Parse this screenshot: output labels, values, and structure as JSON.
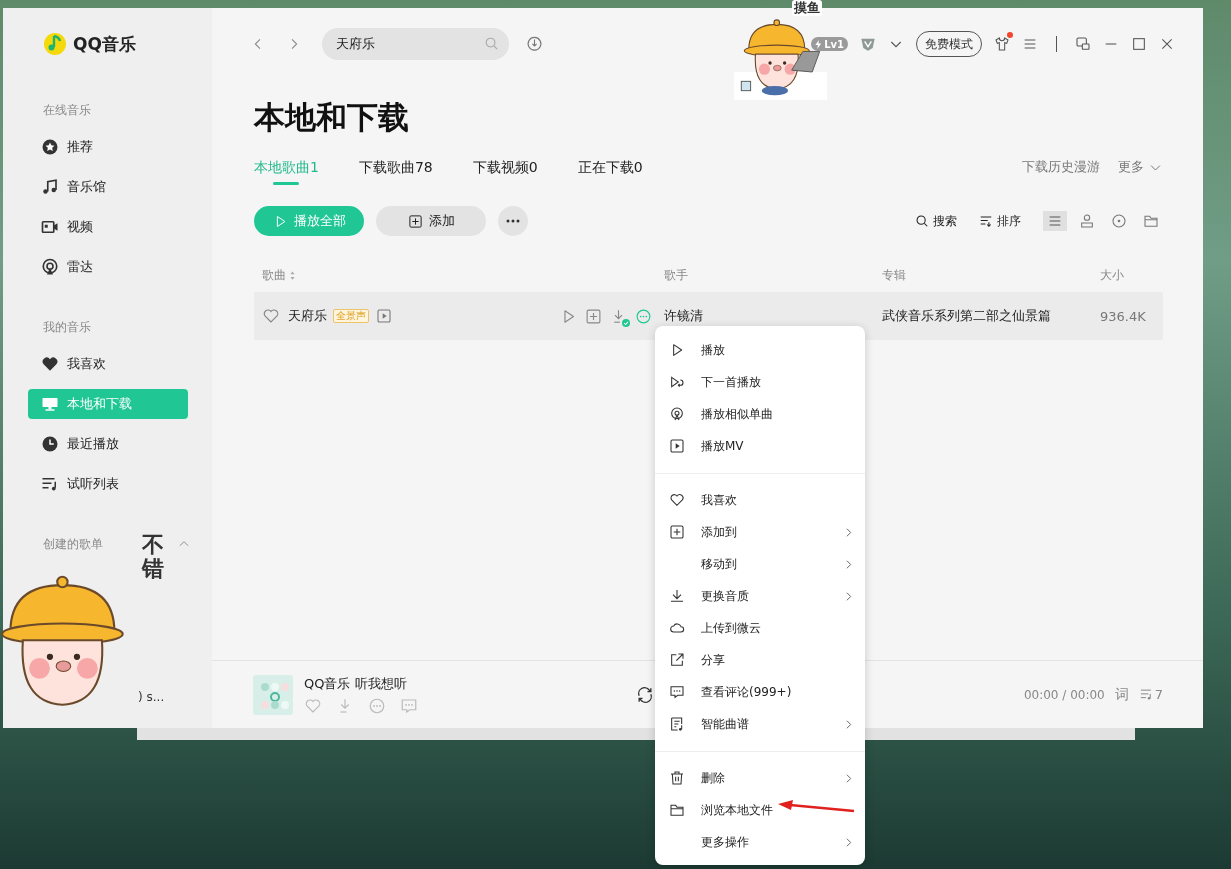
{
  "app": {
    "logo": "QQ音乐"
  },
  "sidebar": {
    "sections": [
      {
        "title": "在线音乐",
        "items": [
          {
            "label": "推荐",
            "selected": false
          },
          {
            "label": "音乐馆",
            "selected": false
          },
          {
            "label": "视频",
            "selected": false
          },
          {
            "label": "雷达",
            "selected": false
          }
        ]
      },
      {
        "title": "我的音乐",
        "items": [
          {
            "label": "我喜欢",
            "selected": false
          },
          {
            "label": "本地和下载",
            "selected": true
          },
          {
            "label": "最近播放",
            "selected": false
          },
          {
            "label": "试听列表",
            "selected": false
          }
        ]
      }
    ],
    "created": {
      "title": "创建的歌单",
      "expanded": true,
      "items": [
        {
          "label": ") s..."
        }
      ]
    }
  },
  "topbar": {
    "search": {
      "value": "天府乐"
    },
    "level_badge": "Lv1",
    "mode_button": "免费模式",
    "skin_notification": true
  },
  "page": {
    "title": "本地和下载",
    "tabs": [
      {
        "label": "本地歌曲1",
        "selected": true
      },
      {
        "label": "下载歌曲78",
        "selected": false
      },
      {
        "label": "下载视频0",
        "selected": false
      },
      {
        "label": "正在下载0",
        "selected": false
      }
    ],
    "links": [
      "下载历史漫游",
      "更多"
    ],
    "buttons": {
      "play_all": "播放全部",
      "add": "添加"
    },
    "tools": [
      "搜索",
      "排序"
    ],
    "views": [
      {
        "selected": true
      },
      {
        "selected": false
      },
      {
        "selected": false
      },
      {
        "selected": false
      }
    ]
  },
  "table": {
    "columns": [
      "歌曲",
      "歌手",
      "专辑",
      "大小"
    ],
    "rows": [
      {
        "title": "天府乐",
        "badge": "全景声",
        "liked": false,
        "downloaded": true,
        "singer": "许镜清",
        "album": "武侠音乐系列第二部之仙景篇",
        "size": "936.4K"
      }
    ]
  },
  "context_menu": {
    "groups": [
      [
        {
          "label": "播放",
          "submenu": false
        },
        {
          "label": "下一首播放",
          "submenu": false
        },
        {
          "label": "播放相似单曲",
          "submenu": false
        },
        {
          "label": "播放MV",
          "submenu": false
        }
      ],
      [
        {
          "label": "我喜欢",
          "submenu": false
        },
        {
          "label": "添加到",
          "submenu": true
        },
        {
          "label": "移动到",
          "submenu": true
        },
        {
          "label": "更换音质",
          "submenu": true
        },
        {
          "label": "上传到微云",
          "submenu": false
        },
        {
          "label": "分享",
          "submenu": false
        },
        {
          "label": "查看评论(999+)",
          "submenu": false
        },
        {
          "label": "智能曲谱",
          "submenu": true
        }
      ],
      [
        {
          "label": "删除",
          "submenu": true
        },
        {
          "label": "浏览本地文件",
          "submenu": false
        },
        {
          "label": "更多操作",
          "submenu": true
        }
      ]
    ]
  },
  "player": {
    "title": "QQ音乐 听我想听",
    "time": "00:00 / 00:00",
    "lyrics": "词",
    "queue_count": "7"
  },
  "stickers": [
    {
      "caption": "摸鱼"
    },
    {
      "caption": "不错"
    }
  ]
}
